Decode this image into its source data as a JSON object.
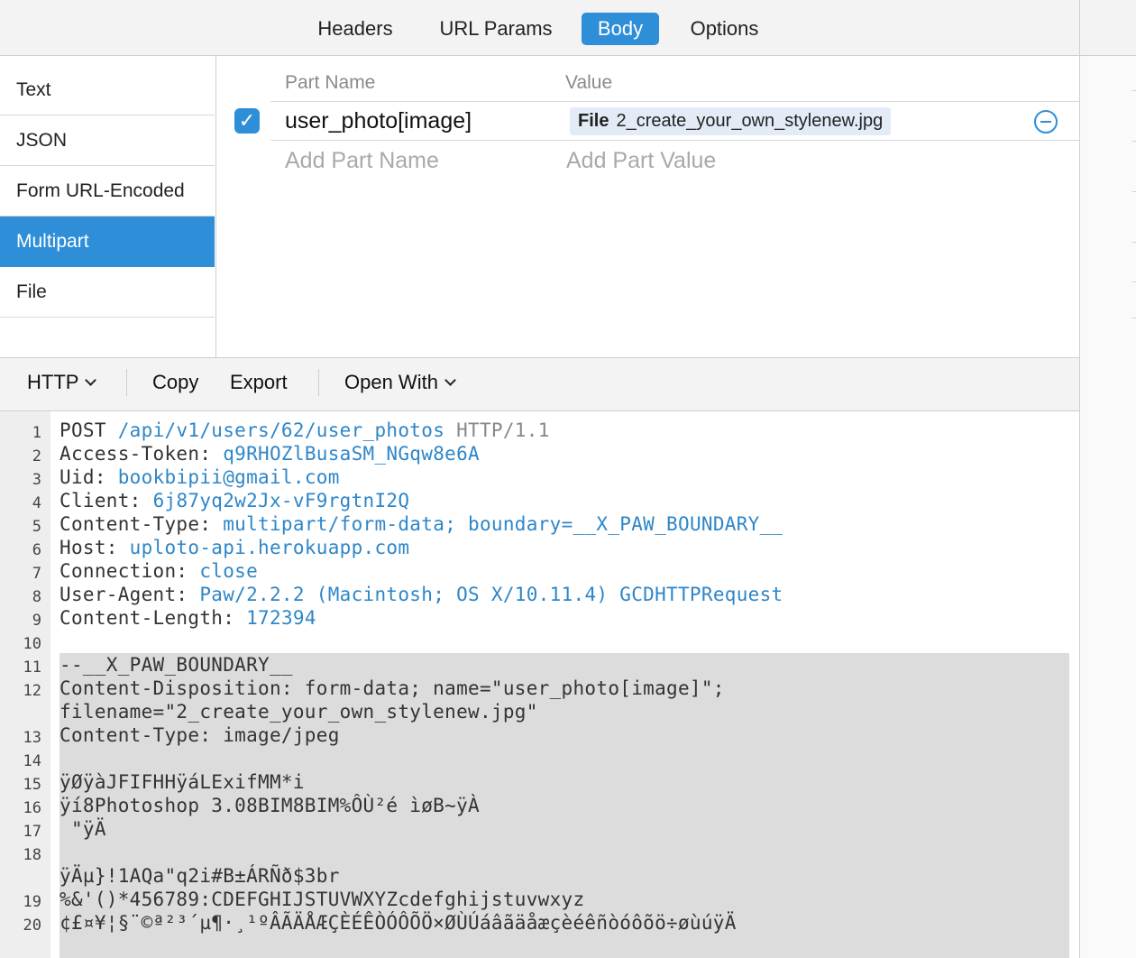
{
  "tabs": [
    "Headers",
    "URL Params",
    "Body",
    "Options"
  ],
  "active_tab": "Body",
  "body_types": [
    "Text",
    "JSON",
    "Form URL-Encoded",
    "Multipart",
    "File"
  ],
  "active_body_type": "Multipart",
  "parts_table": {
    "col_name": "Part Name",
    "col_value": "Value",
    "row": {
      "enabled": true,
      "name": "user_photo[image]",
      "value_kind": "File",
      "value_file": "2_create_your_own_stylenew.jpg"
    },
    "add_name_placeholder": "Add Part Name",
    "add_value_placeholder": "Add Part Value"
  },
  "toolbar": {
    "format": "HTTP",
    "copy": "Copy",
    "export": "Export",
    "open_with": "Open With"
  },
  "code": {
    "line_numbers": [
      "1",
      "2",
      "3",
      "4",
      "5",
      "6",
      "7",
      "8",
      "9",
      "10",
      "11",
      "12",
      "13",
      "14",
      "15",
      "16",
      "17",
      "18",
      "19",
      "20"
    ],
    "request_line": {
      "method": "POST",
      "path": "/api/v1/users/62/user_photos",
      "protocol": "HTTP/1.1"
    },
    "headers": [
      {
        "key": "Access-Token:",
        "value": "q9RHOZlBusaSM_NGqw8e6A"
      },
      {
        "key": "Uid:",
        "value": "bookbipii@gmail.com"
      },
      {
        "key": "Client:",
        "value": "6j87yq2w2Jx-vF9rgtnI2Q"
      },
      {
        "key": "Content-Type:",
        "value": "multipart/form-data; boundary=__X_PAW_BOUNDARY__"
      },
      {
        "key": "Host:",
        "value": "uploto-api.herokuapp.com"
      },
      {
        "key": "Connection:",
        "value": "close"
      },
      {
        "key": "User-Agent:",
        "value": "Paw/2.2.2 (Macintosh; OS X/10.11.4) GCDHTTPRequest"
      },
      {
        "key": "Content-Length:",
        "value": "172394"
      }
    ],
    "body_lines": [
      "--__X_PAW_BOUNDARY__",
      "Content-Disposition: form-data; name=\"user_photo[image]\";",
      "filename=\"2_create_your_own_stylenew.jpg\"",
      "Content-Type: image/jpeg",
      "",
      "ÿØÿàJFIFHHÿáLExifMM*i",
      "ÿí8Photoshop 3.08BIM8BIM%ÔÙ²é ìøB~ÿÀ",
      " \"ÿÄ",
      "",
      "ÿÄµ}!1AQa\"q2i#B±ÁRÑð$3br",
      "%&'()*456789:CDEFGHIJSTUVWXYZcdefghijstuvwxyz",
      "¢£¤¥¦§¨©ª²³´µ¶·¸¹ºÂÃÄÅÆÇÈÉÊÒÓÔÕÖ×ØÙÚáâãäåæçèéêñòóôõö÷øùúÿÄ"
    ]
  },
  "colors": {
    "accent": "#2f8ed8",
    "code_value": "#2e86c8",
    "boundary_bg": "#dcdcdc"
  }
}
